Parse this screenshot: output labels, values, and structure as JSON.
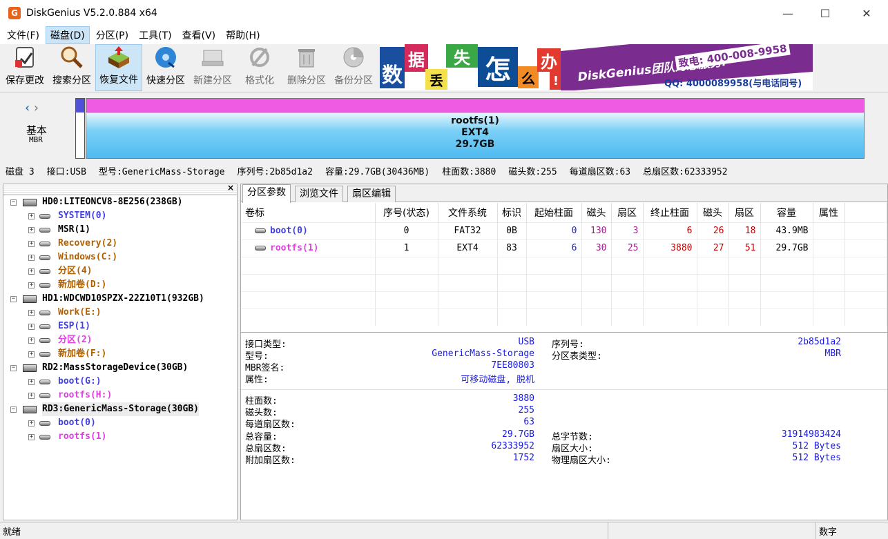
{
  "window": {
    "title": "DiskGenius V5.2.0.884 x64",
    "app_icon": "G",
    "minimize": "—",
    "maximize": "☐",
    "close": "✕"
  },
  "menu": [
    {
      "label": "文件(F)"
    },
    {
      "label": "磁盘(D)"
    },
    {
      "label": "分区(P)"
    },
    {
      "label": "工具(T)"
    },
    {
      "label": "查看(V)"
    },
    {
      "label": "帮助(H)"
    }
  ],
  "toolbar": [
    {
      "label": "保存更改",
      "icon": "save-icon"
    },
    {
      "label": "搜索分区",
      "icon": "magnifier-icon"
    },
    {
      "label": "恢复文件",
      "icon": "recover-icon"
    },
    {
      "label": "快速分区",
      "icon": "disk-blue-icon"
    },
    {
      "label": "新建分区",
      "icon": "new-partition-icon"
    },
    {
      "label": "格式化",
      "icon": "format-icon"
    },
    {
      "label": "删除分区",
      "icon": "trash-icon"
    },
    {
      "label": "备份分区",
      "icon": "backup-icon"
    }
  ],
  "banner": {
    "chars": [
      "数",
      "据",
      "丢",
      "失",
      "怎",
      "么",
      "办",
      "!"
    ],
    "slogan": "DiskGenius团队为您服务!",
    "phone": "致电: 400-008-9958",
    "qq": "QQ: 4000089958(与电话同号)"
  },
  "diskmap": {
    "type": "基本",
    "scheme": "MBR",
    "partition_name": "rootfs(1)",
    "partition_fs": "EXT4",
    "partition_size": "29.7GB"
  },
  "diskinfo": {
    "disk": "磁盘 3",
    "iface": "接口:USB",
    "model": "型号:GenericMass-Storage",
    "serial": "序列号:2b85d1a2",
    "capacity": "容量:29.7GB(30436MB)",
    "cylinders": "柱面数:3880",
    "heads": "磁头数:255",
    "spt": "每道扇区数:63",
    "sectors": "总扇区数:62333952"
  },
  "tree": [
    {
      "label": "HD0:LITEONCV8-8E256(238GB)",
      "kind": "disk",
      "color": "#000000"
    },
    {
      "label": "SYSTEM(0)",
      "kind": "part",
      "color": "#4040e0"
    },
    {
      "label": "MSR(1)",
      "kind": "part",
      "color": "#000000"
    },
    {
      "label": "Recovery(2)",
      "kind": "part",
      "color": "#b06000"
    },
    {
      "label": "Windows(C:)",
      "kind": "part",
      "color": "#b06000"
    },
    {
      "label": "分区(4)",
      "kind": "part",
      "color": "#b06000"
    },
    {
      "label": "新加卷(D:)",
      "kind": "part",
      "color": "#b06000"
    },
    {
      "label": "HD1:WDCWD10SPZX-22Z10T1(932GB)",
      "kind": "disk",
      "color": "#000000"
    },
    {
      "label": "Work(E:)",
      "kind": "part",
      "color": "#b06000"
    },
    {
      "label": "ESP(1)",
      "kind": "part",
      "color": "#4040e0"
    },
    {
      "label": "分区(2)",
      "kind": "part",
      "color": "#e040e0"
    },
    {
      "label": "新加卷(F:)",
      "kind": "part",
      "color": "#b06000"
    },
    {
      "label": "RD2:MassStorageDevice(30GB)",
      "kind": "disk",
      "color": "#000000"
    },
    {
      "label": "boot(G:)",
      "kind": "part",
      "color": "#4040e0"
    },
    {
      "label": "rootfs(H:)",
      "kind": "part",
      "color": "#e040e0"
    },
    {
      "label": "RD3:GenericMass-Storage(30GB)",
      "kind": "disk",
      "color": "#000000"
    },
    {
      "label": "boot(0)",
      "kind": "part",
      "color": "#4040e0"
    },
    {
      "label": "rootfs(1)",
      "kind": "part",
      "color": "#e040e0"
    }
  ],
  "tabs": [
    "分区参数",
    "浏览文件",
    "扇区编辑"
  ],
  "table": {
    "headers": [
      "卷标",
      "序号(状态)",
      "文件系统",
      "标识",
      "起始柱面",
      "磁头",
      "扇区",
      "终止柱面",
      "磁头",
      "扇区",
      "容量",
      "属性"
    ],
    "rows": [
      [
        "boot(0)",
        "0",
        "FAT32",
        "0B",
        "0",
        "130",
        "3",
        "6",
        "26",
        "18",
        "43.9MB",
        ""
      ],
      [
        "rootfs(1)",
        "1",
        "EXT4",
        "83",
        "6",
        "30",
        "25",
        "3880",
        "27",
        "51",
        "29.7GB",
        ""
      ]
    ]
  },
  "info": {
    "iface_label": "接口类型:",
    "iface_value": "USB",
    "model_label": "型号:",
    "model_value": "GenericMass-Storage",
    "mbr_label": "MBR签名:",
    "mbr_value": "7EE80803",
    "attr_label": "属性:",
    "attr_value": "可移动磁盘, 脱机",
    "serial_label": "序列号:",
    "serial_value": "2b85d1a2",
    "ptype_label": "分区表类型:",
    "ptype_value": "MBR",
    "cyl_label": "柱面数:",
    "cyl_value": "3880",
    "heads_label": "磁头数:",
    "heads_value": "255",
    "spt_label": "每道扇区数:",
    "spt_value": "63",
    "cap_label": "总容量:",
    "cap_value": "29.7GB",
    "sectors_label": "总扇区数:",
    "sectors_value": "62333952",
    "extra_label": "附加扇区数:",
    "extra_value": "1752",
    "bytes_label": "总字节数:",
    "bytes_value": "31914983424",
    "ssize_label": "扇区大小:",
    "ssize_value": "512 Bytes",
    "psize_label": "物理扇区大小:",
    "psize_value": "512 Bytes"
  },
  "status": {
    "left": "就绪",
    "right": "数字"
  }
}
